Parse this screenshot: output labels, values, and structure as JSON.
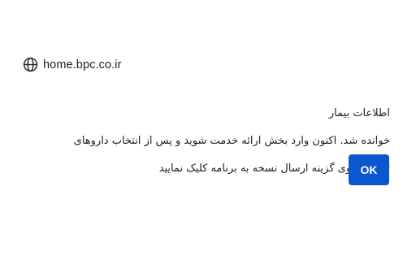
{
  "dialog": {
    "origin": "home.bpc.co.ir",
    "origin_icon": "globe-icon",
    "message_lines": [
      "اطلاعات بیمار",
      "خوانده شد. اکنون وارد بخش ارائه خدمت شوید و پس از انتخاب داروهای",
      "تحویلی روی گزینه ارسال نسخه به برنامه کلیک نمایید"
    ],
    "ok_label": "OK",
    "accent_color": "#0b57d0"
  }
}
